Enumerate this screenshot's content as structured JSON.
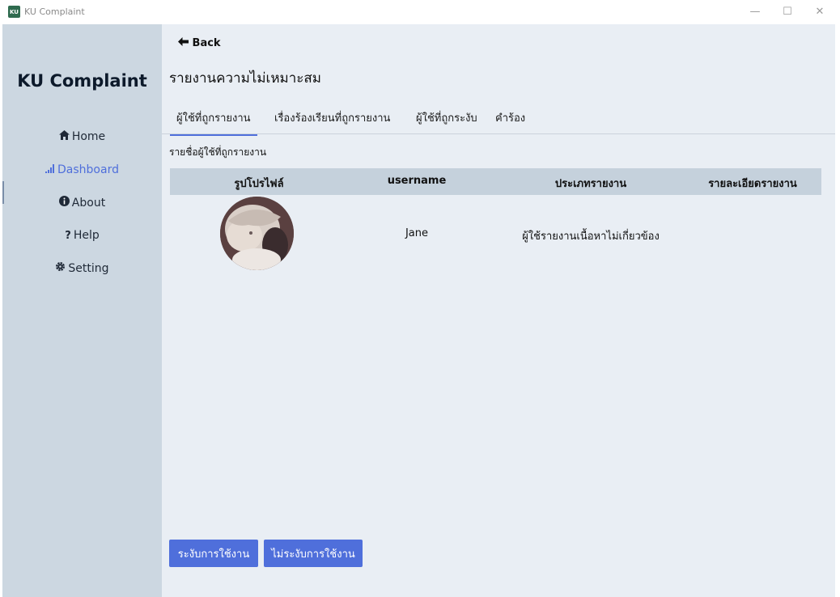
{
  "window": {
    "app_icon_text": "KU",
    "title": "KU Complaint",
    "minimize_glyph": "—",
    "maximize_glyph": "☐",
    "close_glyph": "✕"
  },
  "sidebar": {
    "brand": "KU Complaint",
    "items": [
      {
        "label": "Home",
        "icon": "home-icon",
        "glyph": "🏠"
      },
      {
        "label": "Dashboard",
        "icon": "bar-chart-icon",
        "glyph": "📶",
        "active": true
      },
      {
        "label": "About",
        "icon": "info-icon",
        "glyph": "ℹ"
      },
      {
        "label": "Help",
        "icon": "question-icon",
        "glyph": "?"
      },
      {
        "label": "Setting",
        "icon": "gear-icon",
        "glyph": "⚙"
      }
    ]
  },
  "main": {
    "back_label": "Back",
    "back_glyph": "←",
    "page_title": "รายงานความไม่เหมาะสม",
    "tabs": [
      {
        "label": "ผู้ใช้ที่ถูกรายงาน",
        "active": true
      },
      {
        "label": "เรื่องร้องเรียนที่ถูกรายงาน"
      },
      {
        "label": "ผู้ใช้ที่ถูกระงับ"
      },
      {
        "label": "คำร้อง"
      }
    ],
    "section_label": "รายชื่อผู้ใช้ที่ถูกรายงาน",
    "table": {
      "columns": [
        "รูปโปรไฟล์",
        "username",
        "ประเภทรายงาน",
        "รายละเอียดรายงาน"
      ],
      "rows": [
        {
          "username": "Jane",
          "report_type": "ผู้ใช้รายงานเนื้อหาไม่เกี่ยวข้อง",
          "details": ""
        }
      ]
    },
    "buttons": {
      "suspend": "ระงับการใช้งาน",
      "unsuspend": "ไม่ระงับการใช้งาน"
    }
  },
  "colors": {
    "accent": "#4f6fdb",
    "sidebar_bg": "#ccd7e1",
    "main_bg": "#e9eef4",
    "table_header_bg": "#c5d1dc"
  }
}
